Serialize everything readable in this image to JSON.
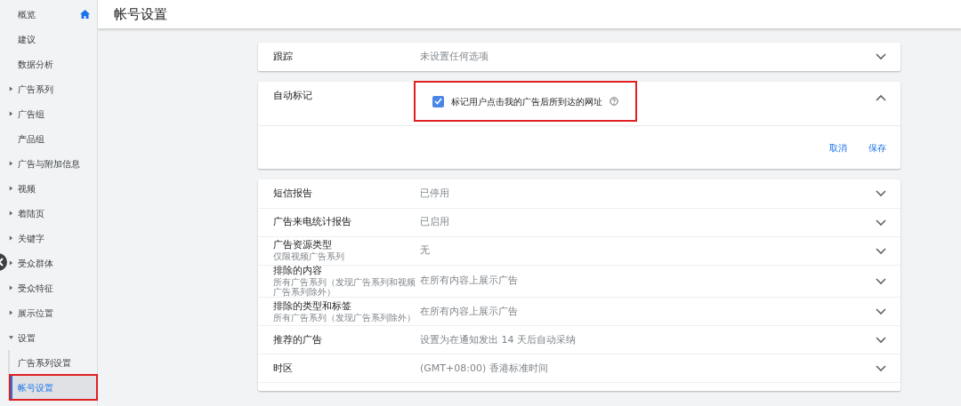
{
  "sidebar": {
    "items": [
      {
        "label": "概览",
        "kind": "home_link",
        "selected": false
      },
      {
        "label": "建议",
        "kind": "link",
        "selected": false
      },
      {
        "label": "数据分析",
        "kind": "link",
        "selected": false
      },
      {
        "label": "广告系列",
        "kind": "group",
        "expanded": false,
        "selected": false
      },
      {
        "label": "广告组",
        "kind": "group",
        "expanded": false,
        "selected": false
      },
      {
        "label": "产品组",
        "kind": "link",
        "selected": false
      },
      {
        "label": "广告与附加信息",
        "kind": "group",
        "expanded": false,
        "selected": false
      },
      {
        "label": "视频",
        "kind": "group",
        "expanded": false,
        "selected": false
      },
      {
        "label": "着陆页",
        "kind": "group",
        "expanded": false,
        "selected": false
      },
      {
        "label": "关键字",
        "kind": "group",
        "expanded": false,
        "selected": false
      },
      {
        "label": "受众群体",
        "kind": "group",
        "expanded": false,
        "selected": false
      },
      {
        "label": "受众特征",
        "kind": "group",
        "expanded": false,
        "selected": false
      },
      {
        "label": "展示位置",
        "kind": "group",
        "expanded": false,
        "selected": false
      },
      {
        "label": "设置",
        "kind": "group",
        "expanded": true,
        "selected": false,
        "children": [
          {
            "label": "广告系列设置",
            "selected": false,
            "highlighted": false
          },
          {
            "label": "帐号设置",
            "selected": true,
            "highlighted": true
          }
        ]
      }
    ]
  },
  "page": {
    "title": "帐号设置"
  },
  "settings": [
    {
      "kind": "summary",
      "label": "跟踪",
      "value": "未设置任何选项",
      "expanded": false
    },
    {
      "kind": "edit",
      "label": "自动标记",
      "expanded": true,
      "checkbox": {
        "label": "标记用户点击我的广告后所到达的网址",
        "checked": true,
        "highlighted": true
      },
      "buttons": [
        "取消",
        "保存"
      ]
    }
  ],
  "settings_group": [
    {
      "label": "短信报告",
      "value": "已停用",
      "expanded": false
    },
    {
      "label": "广告来电统计报告",
      "value": "已启用",
      "expanded": false
    },
    {
      "label": "广告资源类型",
      "sublabel": "仅限视频广告系列",
      "value": "无",
      "expanded": false
    },
    {
      "label": "排除的内容",
      "sublabel": "所有广告系列（发现广告系列和视频广告系列除外）",
      "value": "在所有内容上展示广告",
      "expanded": false
    },
    {
      "label": "排除的类型和标签",
      "sublabel": "所有广告系列（发现广告系列除外）",
      "value": "在所有内容上展示广告",
      "expanded": false
    },
    {
      "label": "推荐的广告",
      "value": "设置为在通知发出 14 天后自动采纳",
      "expanded": false
    },
    {
      "label": "时区",
      "value": "(GMT+08:00) 香港标准时间",
      "expanded": false
    }
  ]
}
